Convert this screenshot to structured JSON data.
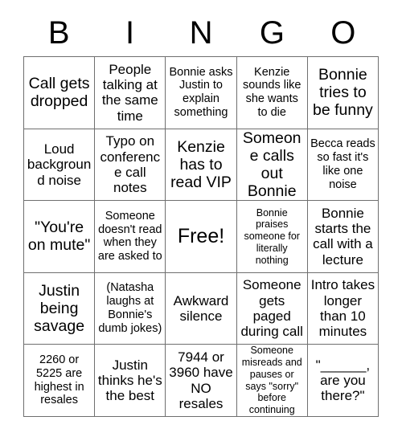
{
  "header": {
    "letters": [
      "B",
      "I",
      "N",
      "G",
      "O"
    ]
  },
  "grid": {
    "rows": [
      [
        {
          "text": "Call gets dropped",
          "size": "t-lg"
        },
        {
          "text": "People talking at the same time",
          "size": "t-md"
        },
        {
          "text": "Bonnie asks Justin to explain something",
          "size": "t-sm"
        },
        {
          "text": "Kenzie sounds like she wants to die",
          "size": "t-sm"
        },
        {
          "text": "Bonnie tries to be funny",
          "size": "t-lg"
        }
      ],
      [
        {
          "text": "Loud background noise",
          "size": "t-md"
        },
        {
          "text": "Typo on conference call notes",
          "size": "t-md"
        },
        {
          "text": "Kenzie has to read VIP",
          "size": "t-lg"
        },
        {
          "text": "Someone calls out Bonnie",
          "size": "t-lg"
        },
        {
          "text": "Becca reads so fast it's like one noise",
          "size": "t-sm"
        }
      ],
      [
        {
          "text": "\"You're on mute\"",
          "size": "t-lg"
        },
        {
          "text": "Someone doesn't read when they are asked to",
          "size": "t-sm"
        },
        {
          "text": "Free!",
          "size": "t-xl"
        },
        {
          "text": "Bonnie praises someone for literally nothing",
          "size": "t-xs"
        },
        {
          "text": "Bonnie starts the call with a lecture",
          "size": "t-md"
        }
      ],
      [
        {
          "text": "Justin being savage",
          "size": "t-lg"
        },
        {
          "text": "(Natasha laughs at Bonnie's dumb jokes)",
          "size": "t-sm"
        },
        {
          "text": "Awkward silence",
          "size": "t-md"
        },
        {
          "text": "Someone gets paged during call",
          "size": "t-md"
        },
        {
          "text": "Intro takes longer than 10 minutes",
          "size": "t-md"
        }
      ],
      [
        {
          "text": "2260 or 5225 are highest in resales",
          "size": "t-sm"
        },
        {
          "text": "Justin thinks he's the best",
          "size": "t-md"
        },
        {
          "text": "7944 or 3960 have NO resales",
          "size": "t-md"
        },
        {
          "text": "Someone misreads and pauses or says \"sorry\" before continuing",
          "size": "t-xs"
        },
        {
          "text": "\"______, are you there?\"",
          "size": "t-md"
        }
      ]
    ]
  },
  "colors": {
    "background": "#ffffff",
    "text": "#000000",
    "grid_line": "#6f6f6f"
  }
}
